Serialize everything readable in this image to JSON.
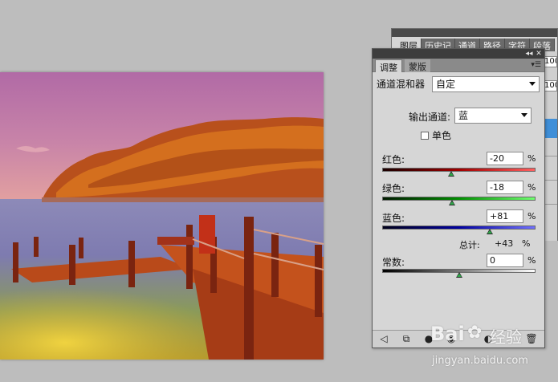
{
  "back_panel": {
    "tabs": [
      "图层",
      "历史记",
      "通道",
      "路径",
      "字符",
      "段落"
    ],
    "values": [
      "100",
      "100"
    ]
  },
  "adjustments_panel": {
    "tabs": [
      "调整",
      "蒙版"
    ],
    "preset_label": "通道混和器",
    "preset_value": "自定",
    "output_channel_label": "输出通道:",
    "output_channel_value": "蓝",
    "monochrome_label": "单色",
    "monochrome_checked": false,
    "red_label": "红色:",
    "red_value": "-20",
    "red_level": -20,
    "green_label": "绿色:",
    "green_value": "-18",
    "green_level": -18,
    "blue_label": "蓝色:",
    "blue_value": "+81",
    "blue_level": 81,
    "total_label": "总计:",
    "total_value": "+43",
    "constant_label": "常数:",
    "constant_value": "0",
    "constant_level": 0,
    "percent": "%"
  },
  "icons": {
    "footer": [
      "back-arrow-icon",
      "clip-to-layer-icon",
      "view-previous-icon",
      "visibility-eye-icon",
      "reset-icon",
      "delete-trash-icon"
    ]
  },
  "colors": {
    "panel_bg": "#d6d6d6",
    "header_bg": "#3d3d3d",
    "selection_blue": "#3f8fd8"
  },
  "watermark": {
    "brand": "Bai",
    "brand_suffix": "经验",
    "url": "jingyan.baidu.com"
  }
}
